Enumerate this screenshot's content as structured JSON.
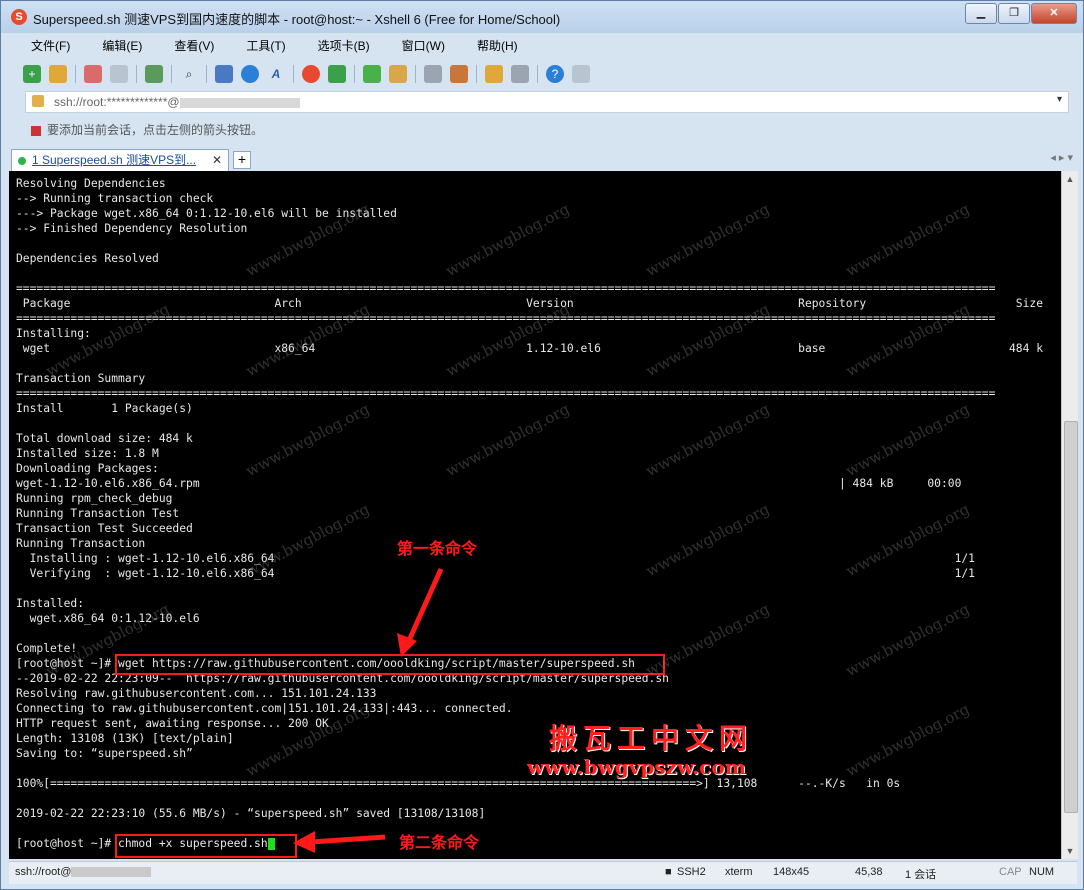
{
  "window": {
    "title": "Superspeed.sh 测速VPS到国内速度的脚本 - root@host:~ - Xshell 6 (Free for Home/School)",
    "controls": {
      "minimize": "▁",
      "maximize": "❐",
      "close": "✕"
    }
  },
  "menu": [
    "文件(F)",
    "编辑(E)",
    "查看(V)",
    "工具(T)",
    "选项卡(B)",
    "窗口(W)",
    "帮助(H)"
  ],
  "address": {
    "text": "ssh://root:*************@",
    "arrow": "▾"
  },
  "hint": "要添加当前会话，点击左侧的箭头按钮。",
  "tab": {
    "label": "1 Superspeed.sh 测速VPS到...",
    "close": "✕",
    "add": "+",
    "nav": "◂ ▸ ▾"
  },
  "terminal": {
    "lines": [
      "Resolving Dependencies",
      "--> Running transaction check",
      "---> Package wget.x86_64 0:1.12-10.el6 will be installed",
      "--> Finished Dependency Resolution",
      "",
      "Dependencies Resolved",
      "",
      "================================================================================================================================================",
      " Package                              Arch                                 Version                                 Repository                      Size",
      "================================================================================================================================================",
      "Installing:",
      " wget                                 x86_64                               1.12-10.el6                             base                           484 k",
      "",
      "Transaction Summary",
      "================================================================================================================================================",
      "Install       1 Package(s)",
      "",
      "Total download size: 484 k",
      "Installed size: 1.8 M",
      "Downloading Packages:",
      "wget-1.12-10.el6.x86_64.rpm                                                                                              | 484 kB     00:00",
      "Running rpm_check_debug",
      "Running Transaction Test",
      "Transaction Test Succeeded",
      "Running Transaction",
      "  Installing : wget-1.12-10.el6.x86_64                                                                                                    1/1",
      "  Verifying  : wget-1.12-10.el6.x86_64                                                                                                    1/1",
      "",
      "Installed:",
      "  wget.x86_64 0:1.12-10.el6",
      "",
      "Complete!",
      "[root@host ~]# wget https://raw.githubusercontent.com/oooldking/script/master/superspeed.sh",
      "--2019-02-22 22:23:09--  https://raw.githubusercontent.com/oooldking/script/master/superspeed.sh",
      "Resolving raw.githubusercontent.com... 151.101.24.133",
      "Connecting to raw.githubusercontent.com|151.101.24.133|:443... connected.",
      "HTTP request sent, awaiting response... 200 OK",
      "Length: 13108 (13K) [text/plain]",
      "Saving to: “superspeed.sh”",
      "",
      "100%[===============================================================================================>] 13,108      --.-K/s   in 0s",
      "",
      "2019-02-22 22:23:10 (55.6 MB/s) - “superspeed.sh” saved [13108/13108]",
      "",
      "[root@host ~]# chmod +x superspeed.sh"
    ]
  },
  "annotations": {
    "first_command": "第一条命令",
    "second_command": "第二条命令",
    "brand_cn": "搬瓦工中文网",
    "brand_url": "www.bwgvpszw.com",
    "watermark": "www.bwgblog.org"
  },
  "status": {
    "connection": "ssh://root@",
    "protocol": "SSH2",
    "term": "xterm",
    "size": "148x45",
    "position": "45,38",
    "sessions": "1 会话",
    "cap": "CAP",
    "num": "NUM"
  }
}
